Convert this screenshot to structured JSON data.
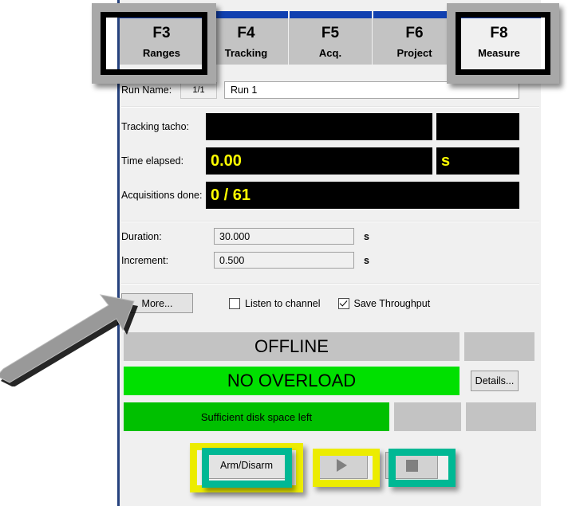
{
  "app": {
    "panel_name": "measurement-control-panel"
  },
  "tabs": [
    {
      "fkey": "F3",
      "label": "Ranges",
      "selected": false,
      "name": "tab-ranges"
    },
    {
      "fkey": "F4",
      "label": "Tracking",
      "selected": false,
      "name": "tab-tracking"
    },
    {
      "fkey": "F5",
      "label": "Acq.",
      "selected": false,
      "name": "tab-acq"
    },
    {
      "fkey": "F6",
      "label": "Project",
      "selected": false,
      "name": "tab-project"
    },
    {
      "fkey": "F8",
      "label": "Measure",
      "selected": true,
      "name": "tab-measure"
    }
  ],
  "run": {
    "label": "Run Name:",
    "counter": "1/1",
    "value": "Run 1",
    "placeholder": "Run 1"
  },
  "readouts": [
    {
      "label": "Tracking tacho:",
      "value": "",
      "unit": ""
    },
    {
      "label": "Time elapsed:",
      "value": "0.00",
      "unit": "s"
    },
    {
      "label": "Acquisitions done:",
      "value": "0 / 61",
      "unit": ""
    }
  ],
  "fields": [
    {
      "label": "Duration:",
      "value": "30.000",
      "unit": "s"
    },
    {
      "label": "Increment:",
      "value": "0.500",
      "unit": "s"
    }
  ],
  "controls": {
    "more_label": "More...",
    "checkboxes": [
      {
        "label": "Listen to channel",
        "checked": false
      },
      {
        "label": "Save Throughput",
        "checked": true
      }
    ]
  },
  "status": [
    {
      "text": "OFFLINE",
      "color": "#c3c3c3",
      "name": "status-connection"
    },
    {
      "text": "NO OVERLOAD",
      "color": "#00e000",
      "name": "status-overload"
    },
    {
      "text": "Sufficient disk space left",
      "color": "#00c000",
      "name": "status-disk"
    }
  ],
  "details_label": "Details...",
  "transport": {
    "arm_label": "Arm/Disarm",
    "play_icon": "play-triangle-icon",
    "stop_icon": "stop-square-icon"
  },
  "annotations": {
    "colors": {
      "gray": "#a8a8a8",
      "yellow": "#ecec00",
      "teal": "#00b894",
      "shadow": "#000000"
    },
    "arrow": {
      "name": "pointer-arrow-to-more-button",
      "fill": "#999999"
    }
  }
}
